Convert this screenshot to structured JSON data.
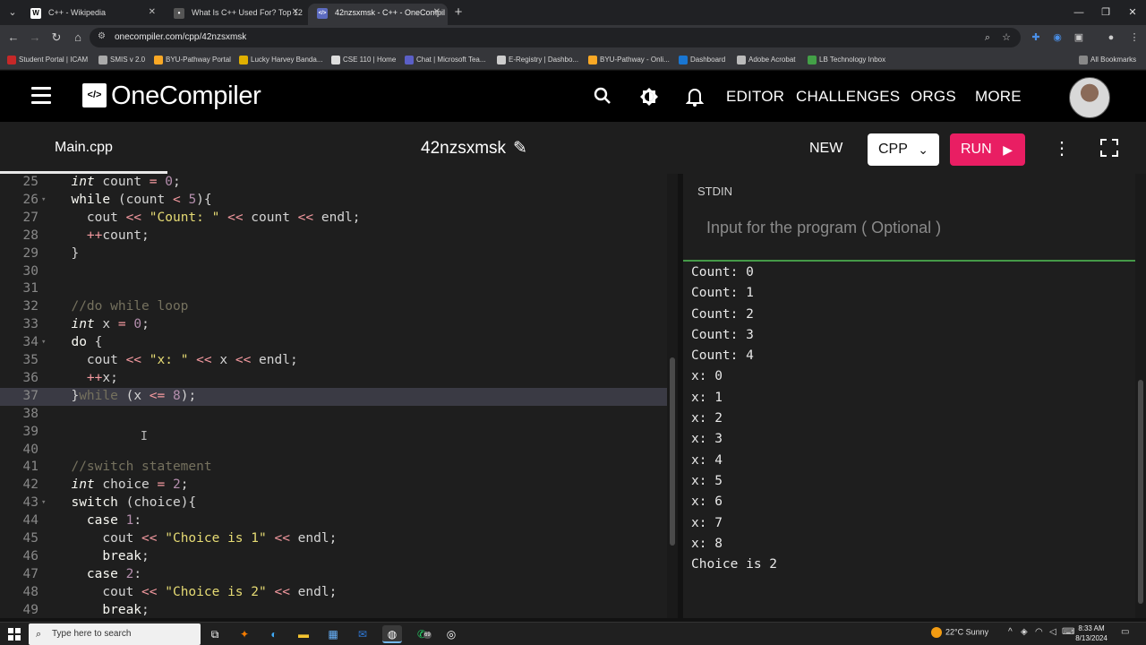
{
  "browser": {
    "tabs": [
      {
        "favicon": "W",
        "title": "C++ - Wikipedia",
        "active": false
      },
      {
        "favicon": "•",
        "title": "What Is C++ Used For? Top 12",
        "active": false
      },
      {
        "favicon": "</>",
        "title": "42nzsxmsk - C++ - OneCompil",
        "active": true
      }
    ],
    "new_tab": "+",
    "url": "onecompiler.com/cpp/42nzsxmsk",
    "bookmarks": [
      "Student Portal | ICAM",
      "SMIS v 2.0",
      "BYU-Pathway Portal",
      "Lucky Harvey Banda...",
      "CSE 110 | Home",
      "Chat | Microsoft Tea...",
      "E-Registry | Dashbo...",
      "BYU-Pathway - Onli...",
      "Dashboard",
      "Adobe Acrobat",
      "LB Technology Inbox"
    ],
    "all_bookmarks": "All Bookmarks"
  },
  "header": {
    "logo_text": "OneCompiler",
    "logo_mark": "</>",
    "nav": [
      "EDITOR",
      "CHALLENGES",
      "ORGS",
      "MORE"
    ]
  },
  "toolbar": {
    "file_tab": "Main.cpp",
    "program_title": "42nzsxmsk",
    "new_label": "NEW",
    "language": "CPP",
    "run_label": "RUN"
  },
  "editor": {
    "current_line": 37,
    "lines": [
      {
        "n": "25",
        "fold": false,
        "html": "  <span class=\"kw\">int</span> count <span class=\"op\">=</span> <span class=\"num\">0</span>;"
      },
      {
        "n": "26",
        "fold": true,
        "html": "  <span class=\"ctl\">while</span> (count <span class=\"op\">&lt;</span> <span class=\"num\">5</span>){"
      },
      {
        "n": "27",
        "fold": false,
        "html": "    cout <span class=\"op\">&lt;&lt;</span> <span class=\"str\">\"Count: \"</span> <span class=\"op\">&lt;&lt;</span> count <span class=\"op\">&lt;&lt;</span> endl;"
      },
      {
        "n": "28",
        "fold": false,
        "html": "    <span class=\"op\">++</span>count;"
      },
      {
        "n": "29",
        "fold": false,
        "html": "  }"
      },
      {
        "n": "30",
        "fold": false,
        "html": ""
      },
      {
        "n": "31",
        "fold": false,
        "html": ""
      },
      {
        "n": "32",
        "fold": false,
        "html": "  <span class=\"cm\">//do while loop</span>"
      },
      {
        "n": "33",
        "fold": false,
        "html": "  <span class=\"kw\">int</span> x <span class=\"op\">=</span> <span class=\"num\">0</span>;"
      },
      {
        "n": "34",
        "fold": true,
        "html": "  <span class=\"ctl\">do</span> {"
      },
      {
        "n": "35",
        "fold": false,
        "html": "    cout <span class=\"op\">&lt;&lt;</span> <span class=\"str\">\"x: \"</span> <span class=\"op\">&lt;&lt;</span> x <span class=\"op\">&lt;&lt;</span> endl;"
      },
      {
        "n": "36",
        "fold": false,
        "html": "    <span class=\"op\">++</span>x;"
      },
      {
        "n": "37",
        "fold": false,
        "html": "  }<span class=\"cm\">while</span> (x <span class=\"op\">&lt;=</span> <span class=\"num\">8</span>);"
      },
      {
        "n": "38",
        "fold": false,
        "html": ""
      },
      {
        "n": "39",
        "fold": false,
        "html": ""
      },
      {
        "n": "40",
        "fold": false,
        "html": ""
      },
      {
        "n": "41",
        "fold": false,
        "html": "  <span class=\"cm\">//switch statement</span>"
      },
      {
        "n": "42",
        "fold": false,
        "html": "  <span class=\"kw\">int</span> choice <span class=\"op\">=</span> <span class=\"num\">2</span>;"
      },
      {
        "n": "43",
        "fold": true,
        "html": "  <span class=\"ctl\">switch</span> (choice){"
      },
      {
        "n": "44",
        "fold": false,
        "html": "    <span class=\"ctl\">case</span> <span class=\"num\">1</span>:"
      },
      {
        "n": "45",
        "fold": false,
        "html": "      cout <span class=\"op\">&lt;&lt;</span> <span class=\"str\">\"Choice is 1\"</span> <span class=\"op\">&lt;&lt;</span> endl;"
      },
      {
        "n": "46",
        "fold": false,
        "html": "      <span class=\"ctl\">break</span>;"
      },
      {
        "n": "47",
        "fold": false,
        "html": "    <span class=\"ctl\">case</span> <span class=\"num\">2</span>:"
      },
      {
        "n": "48",
        "fold": false,
        "html": "      cout <span class=\"op\">&lt;&lt;</span> <span class=\"str\">\"Choice is 2\"</span> <span class=\"op\">&lt;&lt;</span> endl;"
      },
      {
        "n": "49",
        "fold": false,
        "html": "      <span class=\"ctl\">break</span>;"
      }
    ]
  },
  "stdin": {
    "label": "STDIN",
    "placeholder": "Input for the program ( Optional )"
  },
  "output": [
    "Count: 0",
    "Count: 1",
    "Count: 2",
    "Count: 3",
    "Count: 4",
    "x: 0",
    "x: 1",
    "x: 2",
    "x: 3",
    "x: 4",
    "x: 5",
    "x: 6",
    "x: 7",
    "x: 8",
    "Choice is 2"
  ],
  "taskbar": {
    "search_placeholder": "Type here to search",
    "weather": "22°C  Sunny",
    "time": "8:33 AM",
    "date": "8/13/2024",
    "whatsapp_badge": "69"
  },
  "colors": {
    "run_button": "#e91e63",
    "stdin_divider": "#4caf50",
    "current_line_bg": "#3a3a44"
  }
}
